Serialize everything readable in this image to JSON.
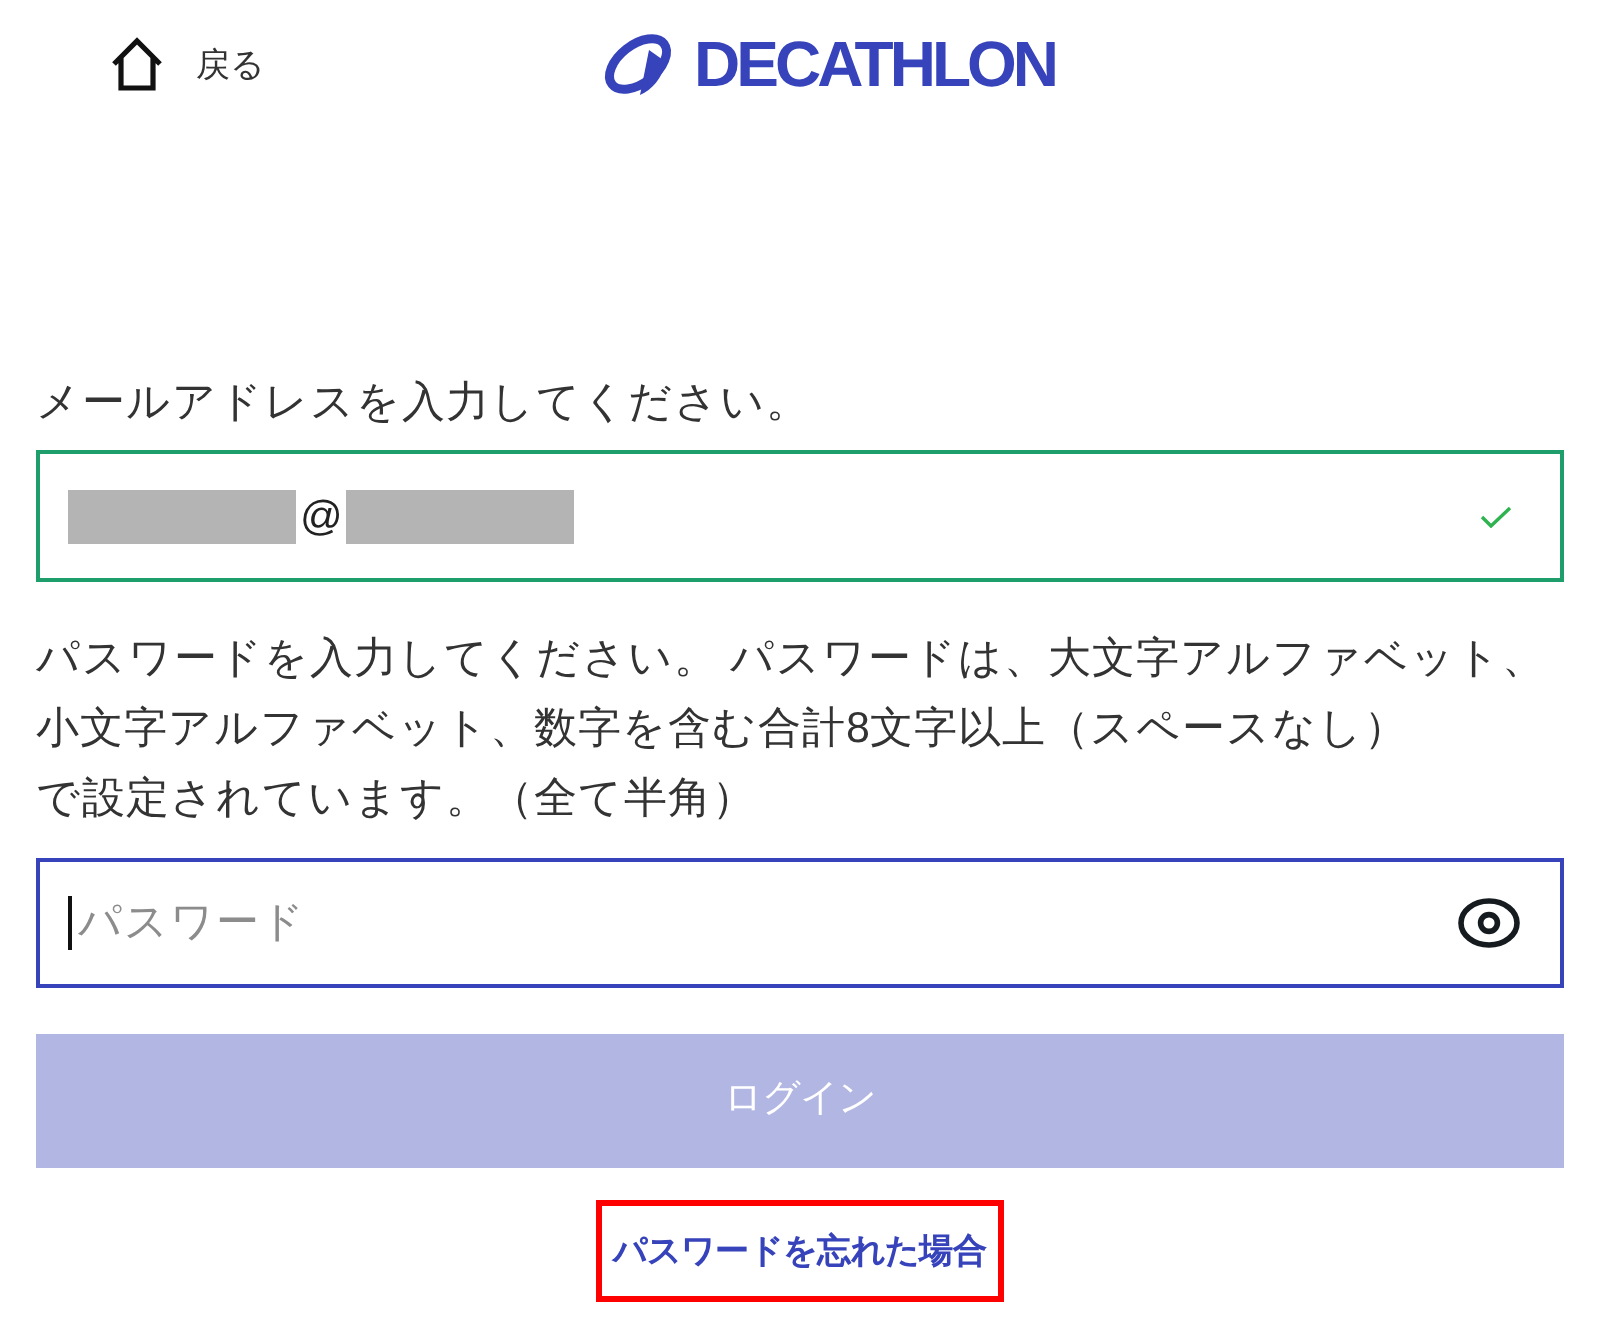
{
  "header": {
    "back": {
      "label": "戻る"
    },
    "logo": {
      "text": "DECATHLON"
    }
  },
  "email": {
    "label": "メールアドレスを入力してください。",
    "value_parts": [
      {
        "kind": "redacted"
      },
      {
        "kind": "text",
        "text": "@"
      },
      {
        "kind": "redacted"
      }
    ],
    "valid": true
  },
  "password": {
    "instructions": "パスワードを入力してください。 パスワードは、大文字アルファベット、小文字アルファベット、数字を含む合計8文字以上（スペースなし）で設定されています。（全て半角）",
    "placeholder": "パスワード",
    "focused": true
  },
  "login_button": {
    "label": "ログイン",
    "disabled": true
  },
  "forgot_password_link": {
    "label": "パスワードを忘れた場合",
    "highlighted": true
  }
}
